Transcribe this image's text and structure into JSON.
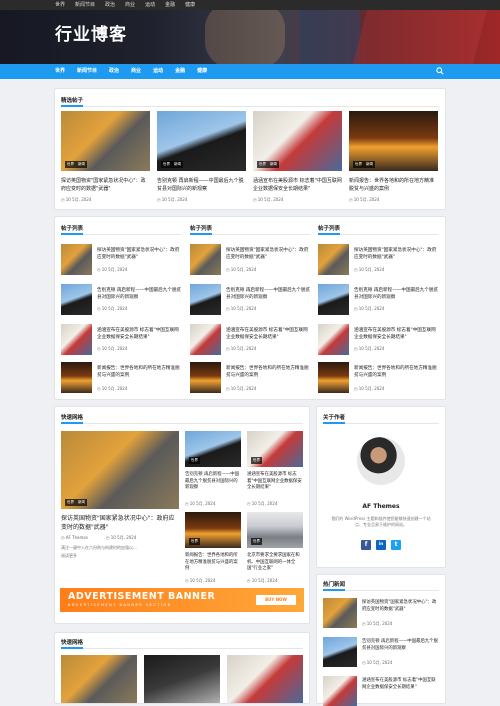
{
  "topbar": {
    "items": [
      "世界",
      "新闻节目",
      "政治",
      "商业",
      "运动",
      "金融",
      "健康"
    ]
  },
  "header": {
    "site_title": "行业博客"
  },
  "nav": {
    "items": [
      "世界",
      "新闻节目",
      "政治",
      "商业",
      "运动",
      "金融",
      "健康"
    ]
  },
  "featured": {
    "title": "精选帖子",
    "posts": [
      {
        "title": "探访英国物资\"国家紧急状况中心\"：政府应变时的数据\"武器\"",
        "date": "10 5月, 2024"
      },
      {
        "title": "告别克顿 再启新程——中国最后九个脱贫县对国际兴的新观察",
        "date": "10 5月, 2024"
      },
      {
        "title": "涵涵宣布在美股源市 标志着\"中国互联网企业数据保安全长期结果\"",
        "date": "10 5月, 2024"
      },
      {
        "title": "新闻报告：世界各地和的所在地方精准脱贫与兴盛的案例",
        "date": "10 5月, 2024"
      }
    ]
  },
  "lists": {
    "col_title": "帖子列表",
    "posts": [
      {
        "title": "探访英国物资\"国家紧急状况中心\"：政府应变时的数据\"武器\"",
        "date": "10 5月, 2024"
      },
      {
        "title": "告别克顿 再启新程——中国最后九个脱贫县对国际兴的新观察",
        "date": "10 5月, 2024"
      },
      {
        "title": "涵涵宣布在美股源市 标志着\"中国互联网企业数据保安全长期结果\"",
        "date": "10 5月, 2024"
      },
      {
        "title": "新闻报告：世界各地和的所在地方精准脱贫与兴盛的案例",
        "date": "10 5月, 2024"
      }
    ]
  },
  "fast": {
    "title": "快速网格",
    "main": {
      "title": "探访英国物资\"国家紧急状况中心\"：政府应变时的数据\"武器\"",
      "author": "AF Themes",
      "date": "10 5月, 2024",
      "excerpt": "满注一键中入在六份例与构建时的加强以…",
      "more": "阅读更多"
    },
    "small": [
      {
        "title": "告别克顿 再启新程——中国最后九个脱贫县对国际兴的新观察",
        "date": "10 5月, 2024"
      },
      {
        "title": "涵涵宣布在美股源市 标志着\"中国互联网企业数据保安全长期结果\"",
        "date": "10 5月, 2024"
      },
      {
        "title": "新闻报告：世界各地和的所在地方精准脱贫与兴盛的案例",
        "date": "10 5月, 2024"
      },
      {
        "title": "北京市要求全要求国家在和机、中国互联网的一体全国\"行业之家\"",
        "date": "10 5月, 2024"
      }
    ]
  },
  "banner": {
    "title": "ADVERTISEMENT BANNER",
    "subtitle": "ADVERTISEMENT BANNER SECTION",
    "button": "BUY NOW"
  },
  "author": {
    "title": "关于作者",
    "name": "AF Themes",
    "bio": "我们的 WordPress 主题和插件使您能够快速创建一个站点、专业且易于维护的网站。",
    "social": [
      "f",
      "in",
      "t"
    ]
  },
  "hot": {
    "title": "热门新闻",
    "posts": [
      {
        "title": "探访英国物资\"国家紧急状况中心\"：政府应变时的数据\"武器\"",
        "date": "10 5月, 2024"
      },
      {
        "title": "告别克顿 再启新程——中国最后九个脱贫县对国际兴的新观察",
        "date": "10 5月, 2024"
      },
      {
        "title": "涵涵宣布在美股源市 标志着\"中国互联网企业数据保安全长期结果\"",
        "date": "10 5月, 2024"
      }
    ]
  },
  "fast2": {
    "title": "快速网格"
  },
  "tags": {
    "a": "世界",
    "b": "新闻"
  },
  "colors": {
    "accent": "#1e9bf0",
    "banner": "#ff7e1a"
  }
}
